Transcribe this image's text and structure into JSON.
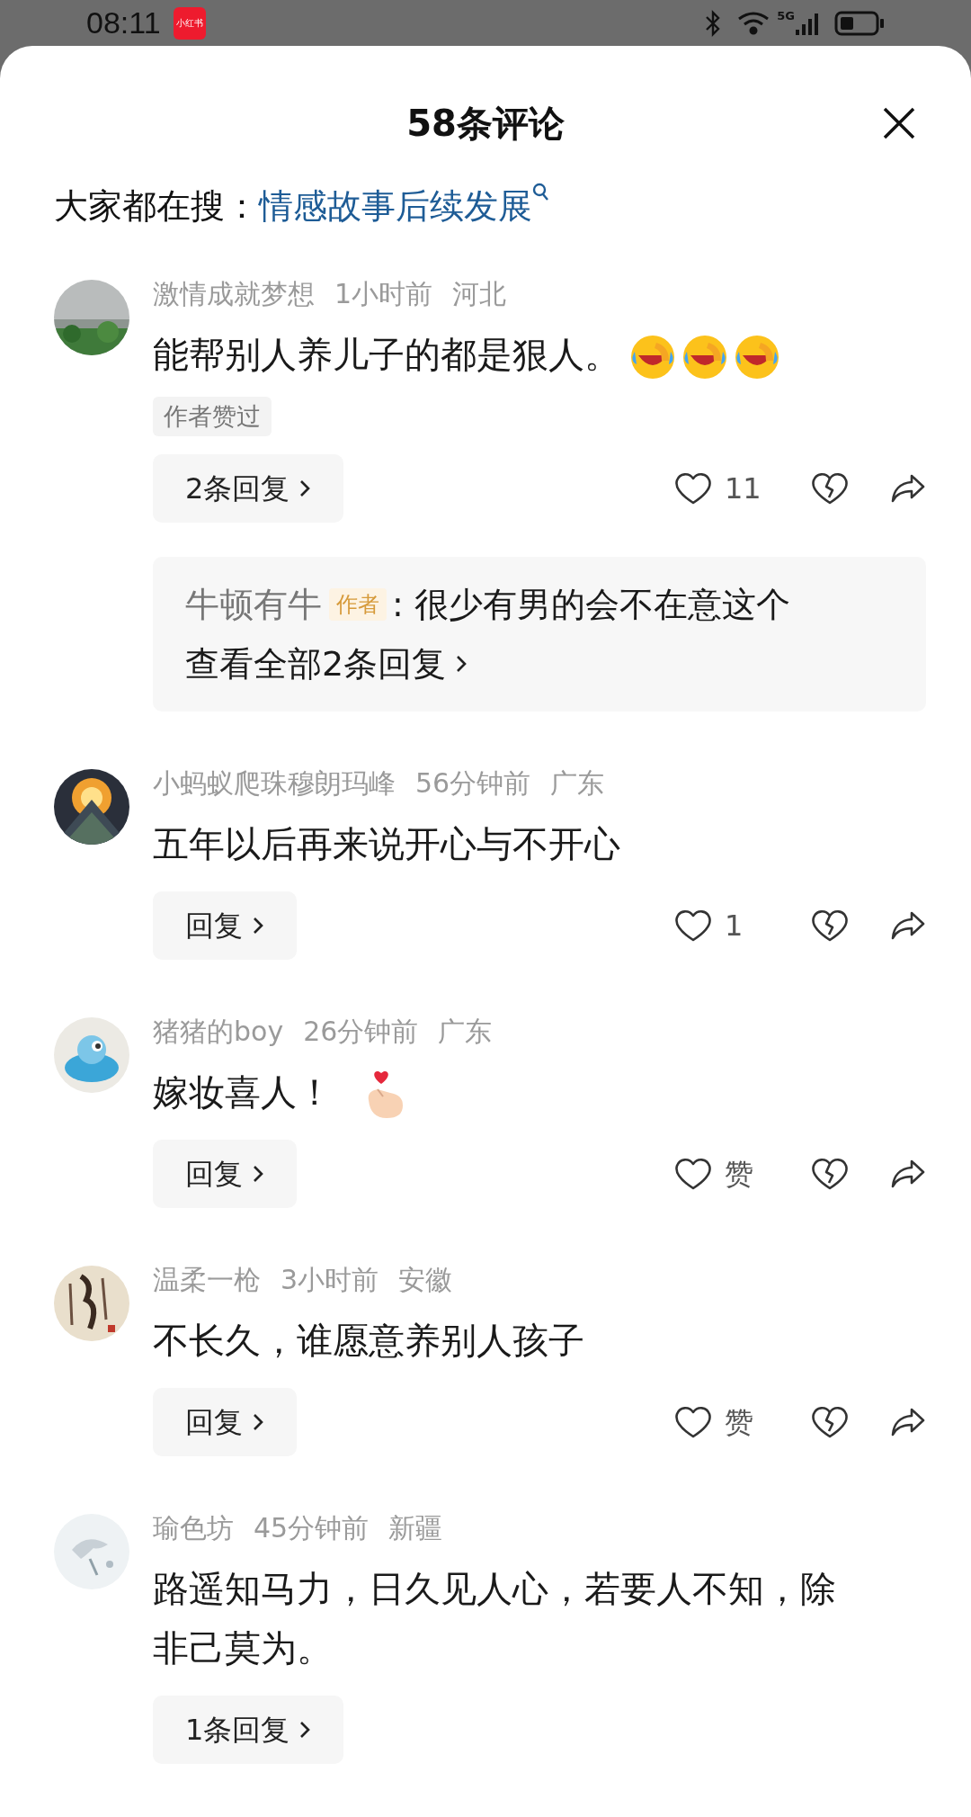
{
  "status_bar": {
    "time": "08:11",
    "app_badge": "小红书",
    "network": "5G"
  },
  "sheet": {
    "title": "58条评论"
  },
  "search_suggestion": {
    "label": "大家都在搜：",
    "query": "情感故事后续发展"
  },
  "comments": [
    {
      "author": "激情成就梦想",
      "time": "1小时前",
      "location": "河北",
      "text": "能帮别人养儿子的都是狠人。",
      "emojis": [
        {
          "kind": "tears-of-joy"
        },
        {
          "kind": "tears-of-joy"
        },
        {
          "kind": "tears-of-joy"
        }
      ],
      "author_liked": "作者赞过",
      "reply_button": "2条回复",
      "likes": "11",
      "reply_preview": {
        "author": "牛顿有牛",
        "badge": "作者",
        "text": ": 很少有男的会不在意这个",
        "view_all": "查看全部2条回复"
      }
    },
    {
      "author": "小蚂蚁爬珠穆朗玛峰",
      "time": "56分钟前",
      "location": "广东",
      "text": "五年以后再来说开心与不开心",
      "reply_button": "回复",
      "likes": "1"
    },
    {
      "author": "猪猪的boy",
      "time": "26分钟前",
      "location": "广东",
      "text": "嫁妆喜人！",
      "emojis": [
        {
          "kind": "heart-hand"
        }
      ],
      "reply_button": "回复",
      "likes": "赞"
    },
    {
      "author": "温柔一枪",
      "time": "3小时前",
      "location": "安徽",
      "text": "不长久，谁愿意养别人孩子",
      "reply_button": "回复",
      "likes": "赞"
    },
    {
      "author": "瑜色坊",
      "time": "45分钟前",
      "location": "新疆",
      "text": "路遥知马力，日久见人心，若要人不知，除非己莫为。",
      "reply_button": "1条回复"
    }
  ]
}
